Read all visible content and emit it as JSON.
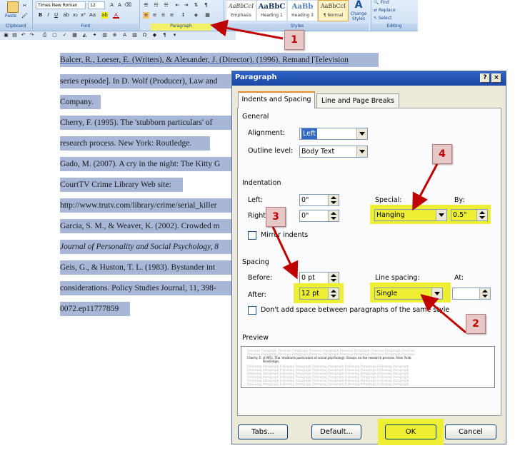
{
  "ribbon": {
    "font_name": "Times New Roman",
    "font_size": "12",
    "paste_label": "Paste",
    "groups": {
      "clipboard": "Clipboard",
      "font": "Font",
      "paragraph": "Paragraph",
      "styles": "Styles",
      "editing": "Editing"
    },
    "styles": [
      {
        "sample": "AaBbCcI",
        "name": "Emphasis"
      },
      {
        "sample": "AaBbC",
        "name": "Heading 1"
      },
      {
        "sample": "AaBb",
        "name": "Heading 3"
      },
      {
        "sample": "AaBbCcI",
        "name": "¶ Normal"
      }
    ],
    "change_styles": "Change Styles",
    "editing": {
      "find": "Find",
      "replace": "Replace",
      "select": "Select"
    }
  },
  "document": {
    "lines": [
      "Balcer, R., Loeser, E. (Writers), & Alexander, J. (Director). (1996). Remand [Television",
      "series episode]. In D. Wolf (Producer), Law and",
      "Company.",
      "Cherry, F. (1995). The 'stubborn particulars' of",
      "research process. New York: Routledge.",
      "Gado, M. (2007). A cry in the night: The Kitty G",
      "CourtTV Crime Library Web site:",
      "http://www.trutv.com/library/crime/serial_killer",
      "Garcia, S. M., & Weaver, K. (2002). Crowded m",
      "Journal of Personality and Social Psychology, 8",
      "Geis, G., & Huston, T. L. (1983). Bystander int",
      "considerations. Policy Studies Journal, 11, 398-",
      "0072.ep11777859"
    ]
  },
  "dialog": {
    "title": "Paragraph",
    "help_button": "?",
    "close_button": "×",
    "tabs": [
      "Indents and Spacing",
      "Line and Page Breaks"
    ],
    "general": {
      "section": "General",
      "alignment_label": "Alignment:",
      "alignment_value": "Left",
      "outline_label": "Outline level:",
      "outline_value": "Body Text"
    },
    "indentation": {
      "section": "Indentation",
      "left_label": "Left:",
      "left_value": "0\"",
      "right_label": "Right:",
      "right_value": "0\"",
      "special_label": "Special:",
      "special_value": "Hanging",
      "by_label": "By:",
      "by_value": "0.5\"",
      "mirror_label": "Mirror indents"
    },
    "spacing": {
      "section": "Spacing",
      "before_label": "Before:",
      "before_value": "0 pt",
      "after_label": "After:",
      "after_value": "12 pt",
      "line_spacing_label": "Line spacing:",
      "line_spacing_value": "Single",
      "at_label": "At:",
      "at_value": "",
      "dont_add_label": "Don't add space between paragraphs of the same style"
    },
    "preview": {
      "section": "Preview",
      "before_text": "Previous Paragraph Previous Paragraph Previous Paragraph Previous Paragraph Previous Paragraph Previous",
      "sample_line_1": "Cherry, F. (1995). The 'stubborn particulars of social psychology: Essays on the research process. New York:",
      "sample_line_2": "Routledge.",
      "after_text": "Following Paragraph Following Paragraph Following Paragraph Following Paragraph Following Paragraph"
    },
    "buttons": {
      "tabs": "Tabs...",
      "default": "Default...",
      "ok": "OK",
      "cancel": "Cancel"
    }
  },
  "callouts": [
    "1",
    "2",
    "3",
    "4"
  ],
  "colors": {
    "highlight": "#eeee33",
    "callout_fill": "#e8c7c7",
    "callout_text": "#c00000",
    "arrow": "#c00000",
    "title_bar": "#2e63c7",
    "doc_highlight": "#a8b6d7"
  }
}
